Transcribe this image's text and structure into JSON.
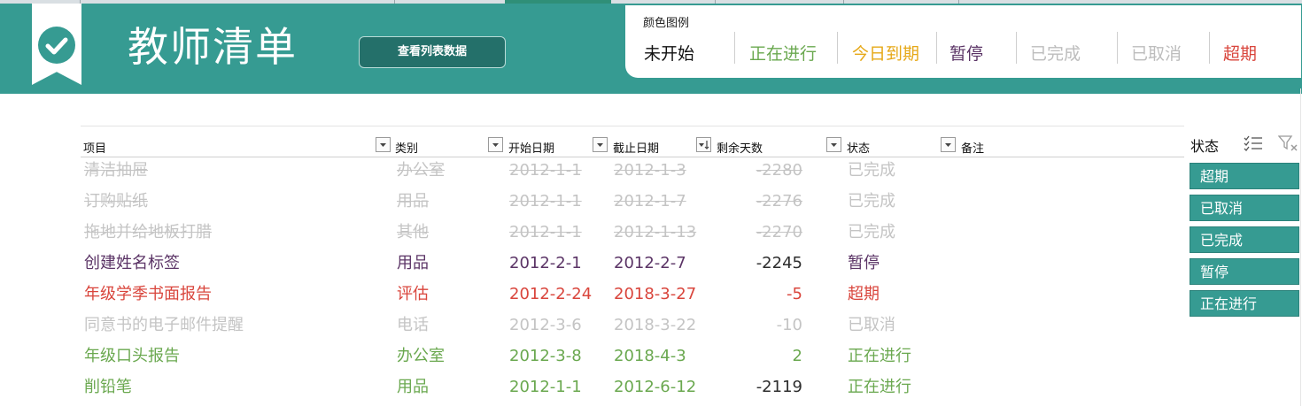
{
  "header": {
    "title": "教师清单",
    "view_button": "查看列表数据"
  },
  "legend": {
    "title": "颜色图例",
    "items": [
      {
        "label": "未开始",
        "color": "#111111"
      },
      {
        "label": "正在进行",
        "color": "#6aa84f"
      },
      {
        "label": "今日到期",
        "color": "#e6a817"
      },
      {
        "label": "暂停",
        "color": "#5b3466"
      },
      {
        "label": "已完成",
        "color": "#bdbdbd"
      },
      {
        "label": "已取消",
        "color": "#bdbdbd"
      },
      {
        "label": "超期",
        "color": "#d9453c"
      }
    ]
  },
  "table": {
    "columns": [
      "项目",
      "类别",
      "开始日期",
      "截止日期",
      "剩余天数",
      "状态",
      "备注"
    ],
    "rows": [
      {
        "item": "清洁抽屉",
        "category": "办公室",
        "start": "2012-1-1",
        "due": "2012-1-3",
        "days": "-2280",
        "status": "已完成",
        "color": "#c4c4c4",
        "strike": true
      },
      {
        "item": "订购贴纸",
        "category": "用品",
        "start": "2012-1-1",
        "due": "2012-1-7",
        "days": "-2276",
        "status": "已完成",
        "color": "#c4c4c4",
        "strike": true
      },
      {
        "item": "拖地并给地板打腊",
        "category": "其他",
        "start": "2012-1-1",
        "due": "2012-1-13",
        "days": "-2270",
        "status": "已完成",
        "color": "#c4c4c4",
        "strike": true
      },
      {
        "item": "创建姓名标签",
        "category": "用品",
        "start": "2012-2-1",
        "due": "2012-2-7",
        "days": "-2245",
        "status": "暂停",
        "color": "#5b3466",
        "strike": false
      },
      {
        "item": "年级学季书面报告",
        "category": "评估",
        "start": "2012-2-24",
        "due": "2018-3-27",
        "days": "-5",
        "status": "超期",
        "color": "#d9453c",
        "strike": false
      },
      {
        "item": "同意书的电子邮件提醒",
        "category": "电话",
        "start": "2012-3-6",
        "due": "2018-3-22",
        "days": "-10",
        "status": "已取消",
        "color": "#c4c4c4",
        "strike": false
      },
      {
        "item": "年级口头报告",
        "category": "办公室",
        "start": "2012-3-8",
        "due": "2018-4-3",
        "days": "2",
        "status": "正在进行",
        "color": "#6aa84f",
        "strike": false
      },
      {
        "item": "削铅笔",
        "category": "用品",
        "start": "2012-1-1",
        "due": "2012-6-12",
        "days": "-2119",
        "status": "正在进行",
        "color": "#6aa84f",
        "strike": false
      }
    ]
  },
  "slicer": {
    "title": "状态",
    "items": [
      "超期",
      "已取消",
      "已完成",
      "暂停",
      "正在进行"
    ],
    "multiselect_icon": "multi-select-icon",
    "clear_filter_icon": "clear-filter-icon"
  },
  "colors": {
    "banner": "#369b92",
    "button_dark": "#24706a"
  }
}
